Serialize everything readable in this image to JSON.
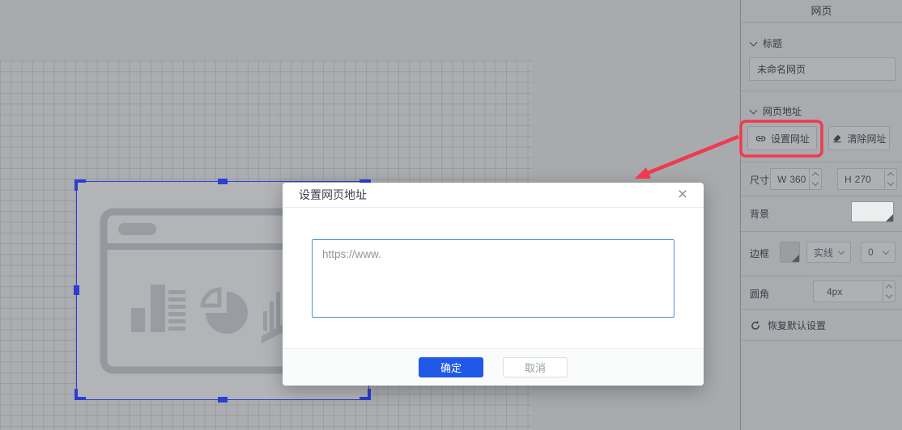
{
  "canvas": {
    "element_name": "webpage-placeholder"
  },
  "panel": {
    "title": "网页",
    "title_section": {
      "label": "标题",
      "name_value": "未命名网页"
    },
    "url_section": {
      "label": "网页地址",
      "set_url_label": "设置网址",
      "clear_url_label": "清除网址"
    },
    "size_row": {
      "label": "尺寸",
      "w_prefix": "W",
      "w_value": "360",
      "h_prefix": "H",
      "h_value": "270"
    },
    "background_row": {
      "label": "背景"
    },
    "border_row": {
      "label": "边框",
      "style_value": "实线",
      "width_value": "0"
    },
    "radius_row": {
      "label": "圆角",
      "value": "4px"
    },
    "reset_label": "恢复默认设置"
  },
  "modal": {
    "title": "设置网页地址",
    "close_symbol": "×",
    "url_value": "https://www.",
    "ok_label": "确定",
    "cancel_label": "取消"
  },
  "colors": {
    "accent_blue": "#2059e8",
    "selection_blue": "#2b3ed0",
    "annotation_red": "#f2394b",
    "textarea_border_blue": "#4a90dd",
    "panel_bg": "#a9abaf",
    "canvas_bg": "#abadb0",
    "placeholder_bg": "#b2b4b7"
  }
}
